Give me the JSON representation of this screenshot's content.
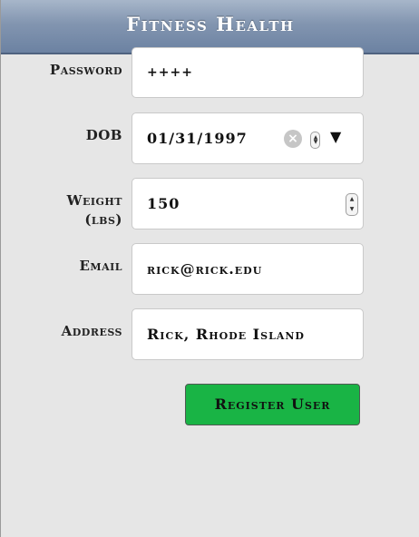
{
  "header": {
    "title": "Fitness Health"
  },
  "form": {
    "password": {
      "label": "Password",
      "value": "++++"
    },
    "dob": {
      "label": "DOB",
      "value": "01/31/1997"
    },
    "weight": {
      "label_line1": "Weight",
      "label_line2": "(lbs)",
      "value": "150"
    },
    "email": {
      "label": "Email",
      "value": "rick@rick.edu"
    },
    "address": {
      "label": "Address",
      "value": "Rick, Rhode Island"
    }
  },
  "actions": {
    "register_label": "Register User"
  },
  "icons": {
    "clear": "clear-circle-icon",
    "spinner": "spinner-arrows-icon",
    "dropdown": "dropdown-triangle-icon"
  },
  "colors": {
    "header_bg": "#8295b0",
    "register_bg": "#19b445",
    "page_bg": "#e6e6e6"
  }
}
